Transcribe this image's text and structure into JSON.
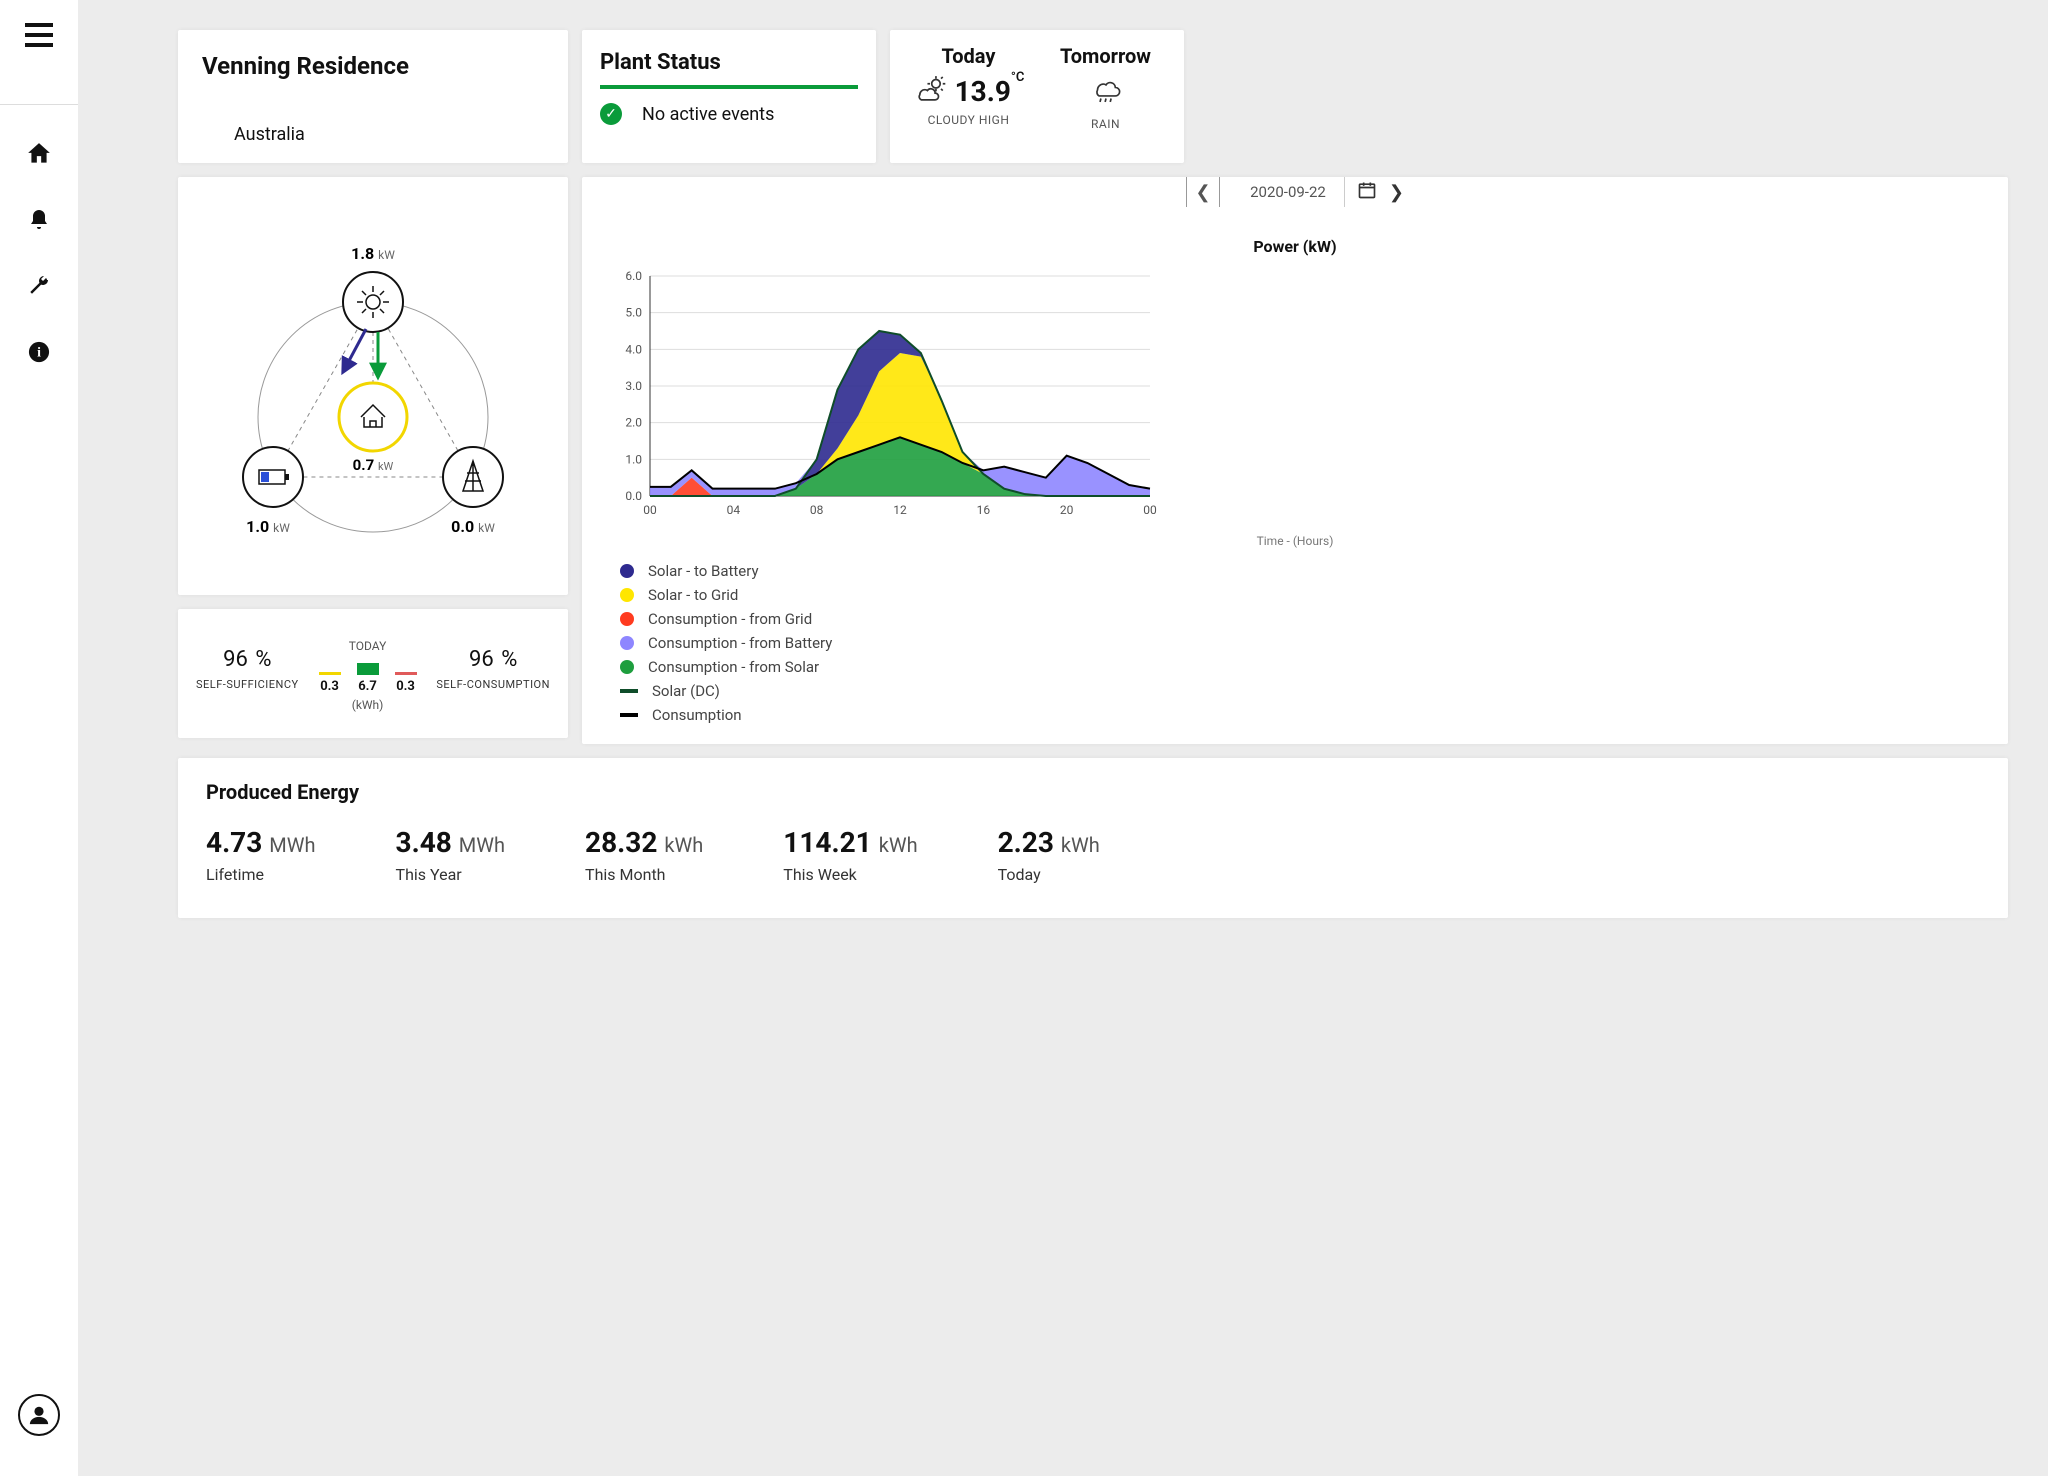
{
  "header": {
    "plant_name": "Venning Residence",
    "location": "Australia"
  },
  "status": {
    "title": "Plant Status",
    "message": "No active events"
  },
  "weather": {
    "today": {
      "label": "Today",
      "temp": "13.9",
      "desc": "CLOUDY HIGH"
    },
    "tomorrow": {
      "label": "Tomorrow",
      "desc": "RAIN"
    }
  },
  "flow": {
    "solar_kw": "1.8",
    "home_kw": "0.7",
    "battery_kw": "1.0",
    "grid_kw": "0.0",
    "unit": "kW"
  },
  "metrics": {
    "self_sufficiency": {
      "value": "96",
      "unit": "%",
      "label": "SELF-SUFFICIENCY"
    },
    "self_consumption": {
      "value": "96",
      "unit": "%",
      "label": "SELF-CONSUMPTION"
    },
    "today_label": "TODAY",
    "today_bars": [
      {
        "value": "0.3",
        "height": 3,
        "color": "#f2d600"
      },
      {
        "value": "6.7",
        "height": 12,
        "color": "#0a9b3a"
      },
      {
        "value": "0.3",
        "height": 3,
        "color": "#e05a5a"
      }
    ],
    "today_unit": "(kWh)"
  },
  "chart_nav": {
    "date": "2020-09-22"
  },
  "chart_data": {
    "type": "area",
    "title": "Power (kW)",
    "xlabel": "Time - (Hours)",
    "ylabel": "kW",
    "ylim": [
      0.0,
      6.0
    ],
    "xticks": [
      "00",
      "04",
      "08",
      "12",
      "16",
      "20",
      "00"
    ],
    "yticks": [
      0.0,
      1.0,
      2.0,
      3.0,
      4.0,
      5.0,
      6.0
    ],
    "x_hours": [
      0,
      1,
      2,
      3,
      4,
      5,
      6,
      7,
      8,
      9,
      10,
      11,
      12,
      13,
      14,
      15,
      16,
      17,
      18,
      19,
      20,
      21,
      22,
      23,
      24
    ],
    "series": [
      {
        "name": "Consumption - from Solar",
        "color": "#1e9e3e",
        "values": [
          0,
          0,
          0,
          0,
          0,
          0,
          0,
          0.2,
          0.6,
          1.0,
          1.2,
          1.4,
          1.6,
          1.4,
          1.2,
          0.9,
          0.6,
          0.2,
          0.05,
          0,
          0,
          0,
          0,
          0,
          0
        ]
      },
      {
        "name": "Solar - to Grid",
        "color": "#ffe600",
        "values": [
          0,
          0,
          0,
          0,
          0,
          0,
          0,
          0,
          0,
          0.3,
          1.0,
          2.0,
          2.3,
          2.4,
          1.4,
          0.3,
          0,
          0,
          0,
          0,
          0,
          0,
          0,
          0,
          0
        ]
      },
      {
        "name": "Solar - to Battery",
        "color": "#2e2a8f",
        "values": [
          0,
          0,
          0,
          0,
          0,
          0,
          0,
          0,
          0.4,
          1.6,
          1.8,
          1.1,
          0.5,
          0.1,
          0,
          0,
          0,
          0,
          0,
          0,
          0,
          0,
          0,
          0,
          0
        ]
      },
      {
        "name": "Consumption - from Grid",
        "color": "#ff3b1f",
        "values": [
          0,
          0,
          0.5,
          0,
          0,
          0,
          0,
          0,
          0,
          0,
          0,
          0,
          0,
          0,
          0,
          0,
          0,
          0,
          0,
          0,
          0,
          0,
          0,
          0,
          0
        ]
      },
      {
        "name": "Consumption - from Battery",
        "color": "#8e86ff",
        "values": [
          0.25,
          0.25,
          0.2,
          0.2,
          0.2,
          0.2,
          0.2,
          0.15,
          0,
          0,
          0,
          0,
          0,
          0,
          0,
          0,
          0.1,
          0.6,
          0.6,
          0.5,
          1.1,
          0.9,
          0.6,
          0.3,
          0.2
        ]
      }
    ],
    "lines": [
      {
        "name": "Solar (DC)",
        "color": "#0f4d2a",
        "values": [
          0,
          0,
          0,
          0,
          0,
          0,
          0,
          0.2,
          1.0,
          2.9,
          4.0,
          4.5,
          4.4,
          3.9,
          2.6,
          1.2,
          0.6,
          0.2,
          0.05,
          0,
          0,
          0,
          0,
          0,
          0
        ]
      },
      {
        "name": "Consumption",
        "color": "#000000",
        "values": [
          0.25,
          0.25,
          0.7,
          0.2,
          0.2,
          0.2,
          0.2,
          0.35,
          0.6,
          1.0,
          1.2,
          1.4,
          1.6,
          1.4,
          1.2,
          0.9,
          0.7,
          0.8,
          0.65,
          0.5,
          1.1,
          0.9,
          0.6,
          0.3,
          0.2
        ]
      }
    ],
    "legend": [
      {
        "name": "Solar - to Battery",
        "color": "#2e2a8f",
        "type": "dot"
      },
      {
        "name": "Solar - to Grid",
        "color": "#ffe600",
        "type": "dot"
      },
      {
        "name": "Consumption - from Grid",
        "color": "#ff3b1f",
        "type": "dot"
      },
      {
        "name": "Consumption - from Battery",
        "color": "#8e86ff",
        "type": "dot"
      },
      {
        "name": "Consumption - from Solar",
        "color": "#1e9e3e",
        "type": "dot"
      },
      {
        "name": "Solar (DC)",
        "color": "#0f4d2a",
        "type": "line"
      },
      {
        "name": "Consumption",
        "color": "#000000",
        "type": "line"
      }
    ]
  },
  "produced": {
    "title": "Produced Energy",
    "items": [
      {
        "value": "4.73",
        "unit": "MWh",
        "label": "Lifetime"
      },
      {
        "value": "3.48",
        "unit": "MWh",
        "label": "This Year"
      },
      {
        "value": "28.32",
        "unit": "kWh",
        "label": "This Month"
      },
      {
        "value": "114.21",
        "unit": "kWh",
        "label": "This Week"
      },
      {
        "value": "2.23",
        "unit": "kWh",
        "label": "Today"
      }
    ]
  }
}
